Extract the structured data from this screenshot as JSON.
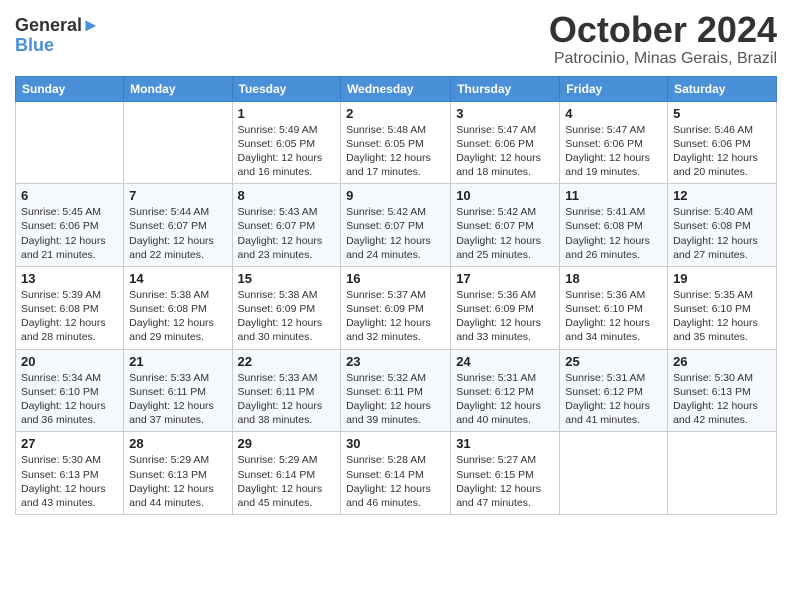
{
  "header": {
    "logo_line1": "General",
    "logo_line2": "Blue",
    "month": "October 2024",
    "location": "Patrocinio, Minas Gerais, Brazil"
  },
  "days_of_week": [
    "Sunday",
    "Monday",
    "Tuesday",
    "Wednesday",
    "Thursday",
    "Friday",
    "Saturday"
  ],
  "weeks": [
    [
      {
        "day": "",
        "info": ""
      },
      {
        "day": "",
        "info": ""
      },
      {
        "day": "1",
        "info": "Sunrise: 5:49 AM\nSunset: 6:05 PM\nDaylight: 12 hours and 16 minutes."
      },
      {
        "day": "2",
        "info": "Sunrise: 5:48 AM\nSunset: 6:05 PM\nDaylight: 12 hours and 17 minutes."
      },
      {
        "day": "3",
        "info": "Sunrise: 5:47 AM\nSunset: 6:06 PM\nDaylight: 12 hours and 18 minutes."
      },
      {
        "day": "4",
        "info": "Sunrise: 5:47 AM\nSunset: 6:06 PM\nDaylight: 12 hours and 19 minutes."
      },
      {
        "day": "5",
        "info": "Sunrise: 5:46 AM\nSunset: 6:06 PM\nDaylight: 12 hours and 20 minutes."
      }
    ],
    [
      {
        "day": "6",
        "info": "Sunrise: 5:45 AM\nSunset: 6:06 PM\nDaylight: 12 hours and 21 minutes."
      },
      {
        "day": "7",
        "info": "Sunrise: 5:44 AM\nSunset: 6:07 PM\nDaylight: 12 hours and 22 minutes."
      },
      {
        "day": "8",
        "info": "Sunrise: 5:43 AM\nSunset: 6:07 PM\nDaylight: 12 hours and 23 minutes."
      },
      {
        "day": "9",
        "info": "Sunrise: 5:42 AM\nSunset: 6:07 PM\nDaylight: 12 hours and 24 minutes."
      },
      {
        "day": "10",
        "info": "Sunrise: 5:42 AM\nSunset: 6:07 PM\nDaylight: 12 hours and 25 minutes."
      },
      {
        "day": "11",
        "info": "Sunrise: 5:41 AM\nSunset: 6:08 PM\nDaylight: 12 hours and 26 minutes."
      },
      {
        "day": "12",
        "info": "Sunrise: 5:40 AM\nSunset: 6:08 PM\nDaylight: 12 hours and 27 minutes."
      }
    ],
    [
      {
        "day": "13",
        "info": "Sunrise: 5:39 AM\nSunset: 6:08 PM\nDaylight: 12 hours and 28 minutes."
      },
      {
        "day": "14",
        "info": "Sunrise: 5:38 AM\nSunset: 6:08 PM\nDaylight: 12 hours and 29 minutes."
      },
      {
        "day": "15",
        "info": "Sunrise: 5:38 AM\nSunset: 6:09 PM\nDaylight: 12 hours and 30 minutes."
      },
      {
        "day": "16",
        "info": "Sunrise: 5:37 AM\nSunset: 6:09 PM\nDaylight: 12 hours and 32 minutes."
      },
      {
        "day": "17",
        "info": "Sunrise: 5:36 AM\nSunset: 6:09 PM\nDaylight: 12 hours and 33 minutes."
      },
      {
        "day": "18",
        "info": "Sunrise: 5:36 AM\nSunset: 6:10 PM\nDaylight: 12 hours and 34 minutes."
      },
      {
        "day": "19",
        "info": "Sunrise: 5:35 AM\nSunset: 6:10 PM\nDaylight: 12 hours and 35 minutes."
      }
    ],
    [
      {
        "day": "20",
        "info": "Sunrise: 5:34 AM\nSunset: 6:10 PM\nDaylight: 12 hours and 36 minutes."
      },
      {
        "day": "21",
        "info": "Sunrise: 5:33 AM\nSunset: 6:11 PM\nDaylight: 12 hours and 37 minutes."
      },
      {
        "day": "22",
        "info": "Sunrise: 5:33 AM\nSunset: 6:11 PM\nDaylight: 12 hours and 38 minutes."
      },
      {
        "day": "23",
        "info": "Sunrise: 5:32 AM\nSunset: 6:11 PM\nDaylight: 12 hours and 39 minutes."
      },
      {
        "day": "24",
        "info": "Sunrise: 5:31 AM\nSunset: 6:12 PM\nDaylight: 12 hours and 40 minutes."
      },
      {
        "day": "25",
        "info": "Sunrise: 5:31 AM\nSunset: 6:12 PM\nDaylight: 12 hours and 41 minutes."
      },
      {
        "day": "26",
        "info": "Sunrise: 5:30 AM\nSunset: 6:13 PM\nDaylight: 12 hours and 42 minutes."
      }
    ],
    [
      {
        "day": "27",
        "info": "Sunrise: 5:30 AM\nSunset: 6:13 PM\nDaylight: 12 hours and 43 minutes."
      },
      {
        "day": "28",
        "info": "Sunrise: 5:29 AM\nSunset: 6:13 PM\nDaylight: 12 hours and 44 minutes."
      },
      {
        "day": "29",
        "info": "Sunrise: 5:29 AM\nSunset: 6:14 PM\nDaylight: 12 hours and 45 minutes."
      },
      {
        "day": "30",
        "info": "Sunrise: 5:28 AM\nSunset: 6:14 PM\nDaylight: 12 hours and 46 minutes."
      },
      {
        "day": "31",
        "info": "Sunrise: 5:27 AM\nSunset: 6:15 PM\nDaylight: 12 hours and 47 minutes."
      },
      {
        "day": "",
        "info": ""
      },
      {
        "day": "",
        "info": ""
      }
    ]
  ]
}
